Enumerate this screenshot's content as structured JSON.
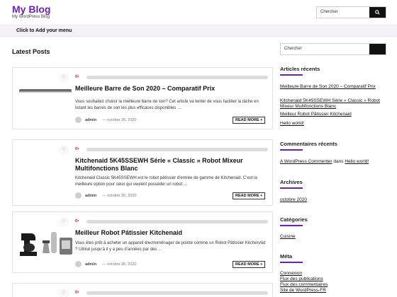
{
  "site": {
    "title": "My Blog",
    "description": "My WordPress Blog"
  },
  "header_search": {
    "placeholder": "Chercher"
  },
  "menu": {
    "label": "Click to Add your menu"
  },
  "main": {
    "heading": "Latest Posts"
  },
  "posts": [
    {
      "likes": "0",
      "title": "Meilleure Barre de Son 2020 – Comparatif Prix",
      "excerpt": "Vous souhaitez choisir la meilleure barre de son? Cet article va tenter de vous faciliter la tâche en listant les barres de son les plus efficaces disponibles …",
      "author": "admin",
      "date": "octobre 26, 2020",
      "read_more": "READ MORE +"
    },
    {
      "likes": "0",
      "title": "Kitchenaid 5K45SSEWH Série « Classic » Robot Mixeur Multifonctions Blanc",
      "excerpt": "Kitchenaid Classic 5K45SSEWH est le robot pâtissier d’entrée de gamme de Kitchenaid. C’est la meilleure option pour ceux qui veulent posséder un robot …",
      "author": "admin",
      "date": "octobre 26, 2020",
      "read_more": "READ MORE +"
    },
    {
      "likes": "0",
      "title": "Meilleur Robot Pâtissier Kitchenaid",
      "excerpt": "Vous êtes prêt à acheter un appareil électroménager de pointe comme un Robot Pâtissier KitchenAid ? Utilisé jusqu’à il y a peu d’années par des …",
      "author": "admin",
      "date": "octobre 26, 2020",
      "read_more": "READ MORE +"
    },
    {
      "likes": "0"
    }
  ],
  "sidebar": {
    "search_placeholder": "Chercher",
    "recent_posts": {
      "title": "Articles récents",
      "items": [
        "Meilleure Barre de Son 2020 – Comparatif Prix",
        "Kitchenaid 5K45SSEWH Série « Classic » Robot Mixeur Multifonctions Blanc",
        "Meilleur Robot Pâtissier Kitchenaid",
        "Hello world!"
      ]
    },
    "recent_comments": {
      "title": "Commentaires récents",
      "author": "A WordPress Commenter",
      "joiner": "dans",
      "post": "Hello world!"
    },
    "archives": {
      "title": "Archives",
      "items": [
        "octobre 2020"
      ]
    },
    "categories": {
      "title": "Catégories",
      "items": [
        "Cuisine"
      ]
    },
    "meta": {
      "title": "Méta",
      "items": [
        "Connexion",
        "Flux des publications",
        "Flux des commentaires",
        "Site de WordPress-FR"
      ]
    }
  },
  "colors": {
    "accent": "#6e1fb5",
    "like": "#d9304c"
  }
}
